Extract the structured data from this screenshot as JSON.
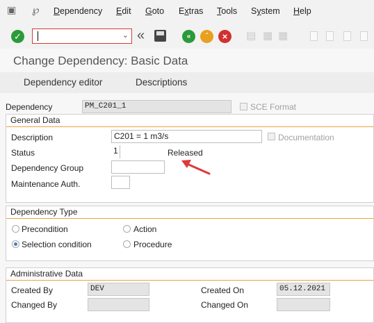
{
  "menu": {
    "items": [
      {
        "label": "Dependency",
        "mnemonic": "D"
      },
      {
        "label": "Edit",
        "mnemonic": "E"
      },
      {
        "label": "Goto",
        "mnemonic": "G"
      },
      {
        "label": "Extras",
        "mnemonic": "x"
      },
      {
        "label": "Tools",
        "mnemonic": "T"
      },
      {
        "label": "System",
        "mnemonic": "y"
      },
      {
        "label": "Help",
        "mnemonic": "H"
      }
    ]
  },
  "toolbar": {
    "command_field_value": "",
    "icons": [
      "enter-icon",
      "double-left-icon",
      "save-icon",
      "back-icon",
      "exit-icon",
      "cancel-icon",
      "print-icon",
      "find-icon",
      "find-next-icon",
      "first-page-icon",
      "previous-page-icon",
      "next-page-icon",
      "last-page-icon"
    ],
    "colors": {
      "enter": "#2b9a3a",
      "back": "#2b9a3a",
      "exit": "#e8a020",
      "cancel": "#d23030"
    }
  },
  "title": "Change Dependency: Basic Data",
  "tabs": [
    "Dependency editor",
    "Descriptions"
  ],
  "header": {
    "dependency_label": "Dependency",
    "dependency_value": "PM_C201_1",
    "sce_format_label": "SCE Format"
  },
  "general": {
    "title": "General Data",
    "description_label": "Description",
    "description_value": "C201 = 1 m3/s",
    "documentation_label": "Documentation",
    "status_label": "Status",
    "status_value": "1",
    "status_text": "Released",
    "group_label": "Dependency Group",
    "group_value": "",
    "auth_label": "Maintenance Auth.",
    "auth_value": ""
  },
  "type": {
    "title": "Dependency Type",
    "options": [
      {
        "label": "Precondition",
        "selected": false
      },
      {
        "label": "Action",
        "selected": false
      },
      {
        "label": "Selection condition",
        "selected": true
      },
      {
        "label": "Procedure",
        "selected": false
      }
    ]
  },
  "admin": {
    "title": "Administrative Data",
    "created_by_label": "Created By",
    "created_by_value": "DEV",
    "changed_by_label": "Changed By",
    "changed_by_value": "",
    "created_on_label": "Created On",
    "created_on_value": "05.12.2021",
    "changed_on_label": "Changed On",
    "changed_on_value": ""
  },
  "annotation_color": "#e0383c"
}
